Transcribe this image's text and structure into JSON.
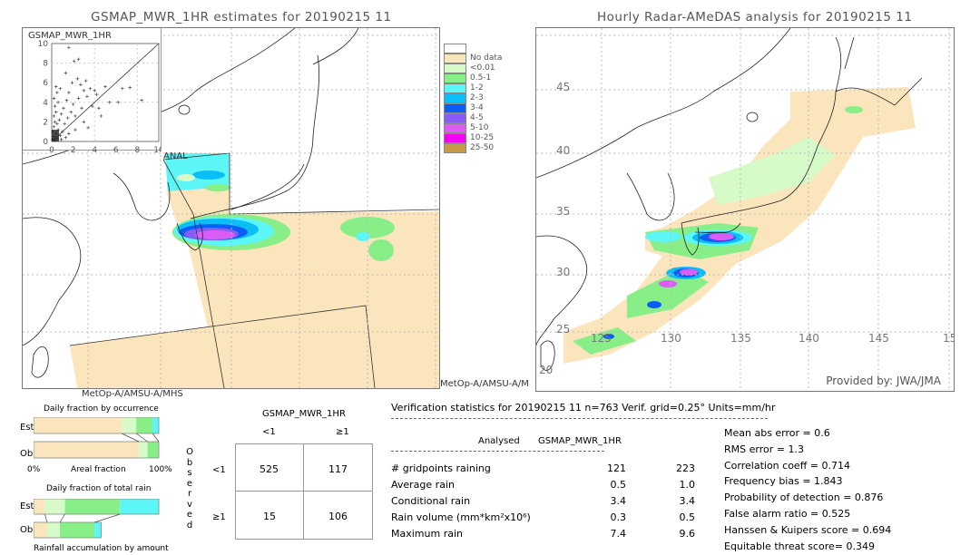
{
  "left_map": {
    "title": "GSMAP_MWR_1HR estimates for 20190215 11",
    "scatter_label": "GSMAP_MWR_1HR",
    "scatter_y_ticks": [
      "10",
      "8",
      "6",
      "4",
      "2",
      "0"
    ],
    "scatter_x_ticks": [
      "2",
      "4",
      "6",
      "8",
      "10"
    ],
    "anal_label": "ANAL",
    "satellite_label": "MetOp-A/AMSU-A/MHS",
    "satellite_label_2": "MetOp-A/AMSU-A/M"
  },
  "right_map": {
    "title": "Hourly Radar-AMeDAS analysis for 20190215 11",
    "lat_labels": [
      "45",
      "40",
      "35",
      "30",
      "25",
      "20"
    ],
    "lon_labels": [
      "125",
      "130",
      "135",
      "140",
      "145",
      "15"
    ],
    "provider": "Provided by: JWA/JMA"
  },
  "legend": {
    "items": [
      {
        "label": "",
        "color": "#ffffff"
      },
      {
        "label": "No data",
        "color": "#fae5bc"
      },
      {
        "label": "<0.01",
        "color": "#d6fbc8"
      },
      {
        "label": "0.5-1",
        "color": "#88ee88"
      },
      {
        "label": "1-2",
        "color": "#5cf6f6"
      },
      {
        "label": "2-3",
        "color": "#0cbef6"
      },
      {
        "label": "3-4",
        "color": "#0a5ef6"
      },
      {
        "label": "4-5",
        "color": "#8a5cf6"
      },
      {
        "label": "5-10",
        "color": "#dc5cf6"
      },
      {
        "label": "10-25",
        "color": "#f400f4"
      },
      {
        "label": "25-50",
        "color": "#c89a48"
      }
    ]
  },
  "fraction_charts": {
    "occurrence_title": "Daily fraction by occurrence",
    "total_rain_title": "Daily fraction of total rain",
    "accumulation_title": "Rainfall accumulation by amount",
    "est_label": "Est",
    "obs_label": "Obs",
    "axis_left": "0%",
    "axis_mid": "Areal fraction",
    "axis_right": "100%"
  },
  "contingency": {
    "title": "GSMAP_MWR_1HR",
    "col_headers": [
      "<1",
      "≥1"
    ],
    "row_headers": [
      "<1",
      "≥1"
    ],
    "observed_label": "Observed",
    "cells": [
      [
        "525",
        "117"
      ],
      [
        "15",
        "106"
      ]
    ]
  },
  "stats": {
    "header": "Verification statistics for 20190215 11   n=763   Verif. grid=0.25°   Units=mm/hr",
    "col_analysed": "Analysed",
    "col_gsmap": "GSMAP_MWR_1HR",
    "rows": [
      {
        "label": "# gridpoints raining",
        "analysed": "121",
        "gsmap": "223"
      },
      {
        "label": "Average rain",
        "analysed": "0.5",
        "gsmap": "1.0"
      },
      {
        "label": "Conditional rain",
        "analysed": "3.4",
        "gsmap": "3.4"
      },
      {
        "label": "Rain volume (mm*km²x10⁶)",
        "analysed": "0.3",
        "gsmap": "0.5"
      },
      {
        "label": "Maximum rain",
        "analysed": "7.4",
        "gsmap": "9.6"
      }
    ],
    "scores": [
      "Mean abs error = 0.6",
      "RMS error = 1.3",
      "Correlation coeff = 0.714",
      "Frequency bias = 1.843",
      "Probability of detection = 0.876",
      "False alarm ratio = 0.525",
      "Hanssen & Kuipers score = 0.694",
      "Equitable threat score= 0.349"
    ]
  },
  "chart_data": [
    {
      "type": "bar",
      "title": "Daily fraction by occurrence",
      "xlabel": "Areal fraction",
      "orientation": "horizontal-stacked",
      "categories": [
        "Est",
        "Obs"
      ],
      "segment_colors": [
        "#fae5bc",
        "#d6fbc8",
        "#88ee88",
        "#5cf6f6"
      ],
      "series": [
        {
          "name": "Est",
          "fractions": [
            0.705,
            0.115,
            0.13,
            0.05
          ]
        },
        {
          "name": "Obs",
          "fractions": [
            0.84,
            0.07,
            0.09,
            0.0
          ]
        }
      ],
      "xlim": [
        0,
        100
      ]
    },
    {
      "type": "bar",
      "title": "Daily fraction of total rain",
      "xlabel": "Rainfall accumulation by amount",
      "orientation": "horizontal-stacked",
      "categories": [
        "Est",
        "Obs"
      ],
      "segment_colors": [
        "#fae5bc",
        "#d6fbc8",
        "#88ee88",
        "#5cf6f6"
      ],
      "series": [
        {
          "name": "Est",
          "total": 1.0,
          "fractions": [
            0.09,
            0.16,
            0.44,
            0.31
          ]
        },
        {
          "name": "Obs",
          "total": 0.54,
          "fractions": [
            0.2,
            0.19,
            0.51,
            0.1
          ]
        }
      ]
    },
    {
      "type": "scatter",
      "title": "GSMAP_MWR_1HR",
      "xlim": [
        0,
        10
      ],
      "ylim": [
        0,
        10
      ],
      "x_ticks": [
        0,
        2,
        4,
        6,
        8,
        10
      ],
      "y_ticks": [
        0,
        2,
        4,
        6,
        8,
        10
      ],
      "points": [
        [
          0.1,
          0.2
        ],
        [
          0.2,
          0.5
        ],
        [
          0.3,
          0.1
        ],
        [
          0.1,
          1.0
        ],
        [
          0.4,
          0.8
        ],
        [
          0.2,
          1.5
        ],
        [
          0.5,
          0.3
        ],
        [
          0.6,
          1.2
        ],
        [
          0.3,
          2.0
        ],
        [
          0.8,
          0.6
        ],
        [
          0.2,
          2.6
        ],
        [
          0.7,
          2.2
        ],
        [
          1.0,
          1.0
        ],
        [
          0.4,
          3.0
        ],
        [
          1.2,
          1.8
        ],
        [
          0.9,
          2.8
        ],
        [
          0.3,
          3.6
        ],
        [
          1.5,
          2.4
        ],
        [
          0.6,
          4.0
        ],
        [
          1.1,
          3.4
        ],
        [
          0.2,
          4.4
        ],
        [
          1.8,
          3.0
        ],
        [
          0.5,
          5.0
        ],
        [
          1.4,
          4.2
        ],
        [
          2.0,
          3.8
        ],
        [
          0.8,
          5.4
        ],
        [
          2.2,
          2.6
        ],
        [
          1.6,
          5.0
        ],
        [
          2.5,
          4.4
        ],
        [
          0.4,
          5.6
        ],
        [
          2.8,
          3.4
        ],
        [
          1.9,
          6.0
        ],
        [
          3.0,
          5.2
        ],
        [
          2.4,
          6.4
        ],
        [
          3.3,
          4.6
        ],
        [
          1.3,
          7.0
        ],
        [
          2.7,
          5.8
        ],
        [
          3.6,
          5.4
        ],
        [
          2.1,
          8.2
        ],
        [
          2.5,
          8.4
        ],
        [
          1.6,
          9.6
        ],
        [
          3.2,
          6.2
        ],
        [
          4.0,
          5.2
        ],
        [
          4.2,
          4.8
        ],
        [
          3.8,
          3.6
        ],
        [
          5.0,
          5.6
        ],
        [
          4.4,
          3.4
        ],
        [
          5.4,
          4.0
        ],
        [
          6.2,
          4.0
        ],
        [
          7.3,
          5.5
        ],
        [
          8.4,
          4.2
        ],
        [
          6.6,
          5.4
        ],
        [
          3.0,
          2.0
        ],
        [
          2.2,
          1.2
        ],
        [
          1.6,
          0.8
        ],
        [
          4.6,
          2.6
        ],
        [
          3.4,
          1.4
        ],
        [
          0.9,
          0.2
        ],
        [
          1.3,
          0.4
        ],
        [
          0.5,
          1.8
        ]
      ]
    }
  ]
}
